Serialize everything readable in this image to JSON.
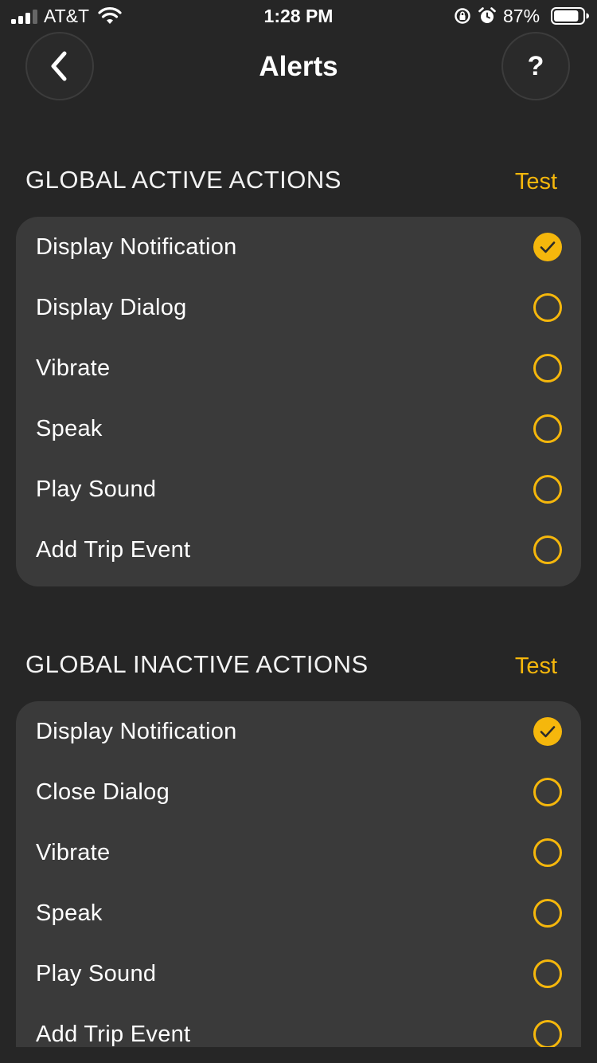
{
  "status_bar": {
    "carrier": "AT&T",
    "time": "1:28 PM",
    "battery_percent": "87%",
    "battery_level": 0.87
  },
  "nav": {
    "title": "Alerts",
    "back_icon": "chevron-left-icon",
    "help_label": "?"
  },
  "accent_color": "#f5b70c",
  "sections": [
    {
      "title": "GLOBAL ACTIVE ACTIONS",
      "test_label": "Test",
      "items": [
        {
          "label": "Display Notification",
          "checked": true
        },
        {
          "label": "Display Dialog",
          "checked": false
        },
        {
          "label": "Vibrate",
          "checked": false
        },
        {
          "label": "Speak",
          "checked": false
        },
        {
          "label": "Play Sound",
          "checked": false
        },
        {
          "label": "Add Trip Event",
          "checked": false
        }
      ]
    },
    {
      "title": "GLOBAL INACTIVE ACTIONS",
      "test_label": "Test",
      "items": [
        {
          "label": "Display Notification",
          "checked": true
        },
        {
          "label": "Close Dialog",
          "checked": false
        },
        {
          "label": "Vibrate",
          "checked": false
        },
        {
          "label": "Speak",
          "checked": false
        },
        {
          "label": "Play Sound",
          "checked": false
        },
        {
          "label": "Add Trip Event",
          "checked": false
        }
      ]
    }
  ]
}
